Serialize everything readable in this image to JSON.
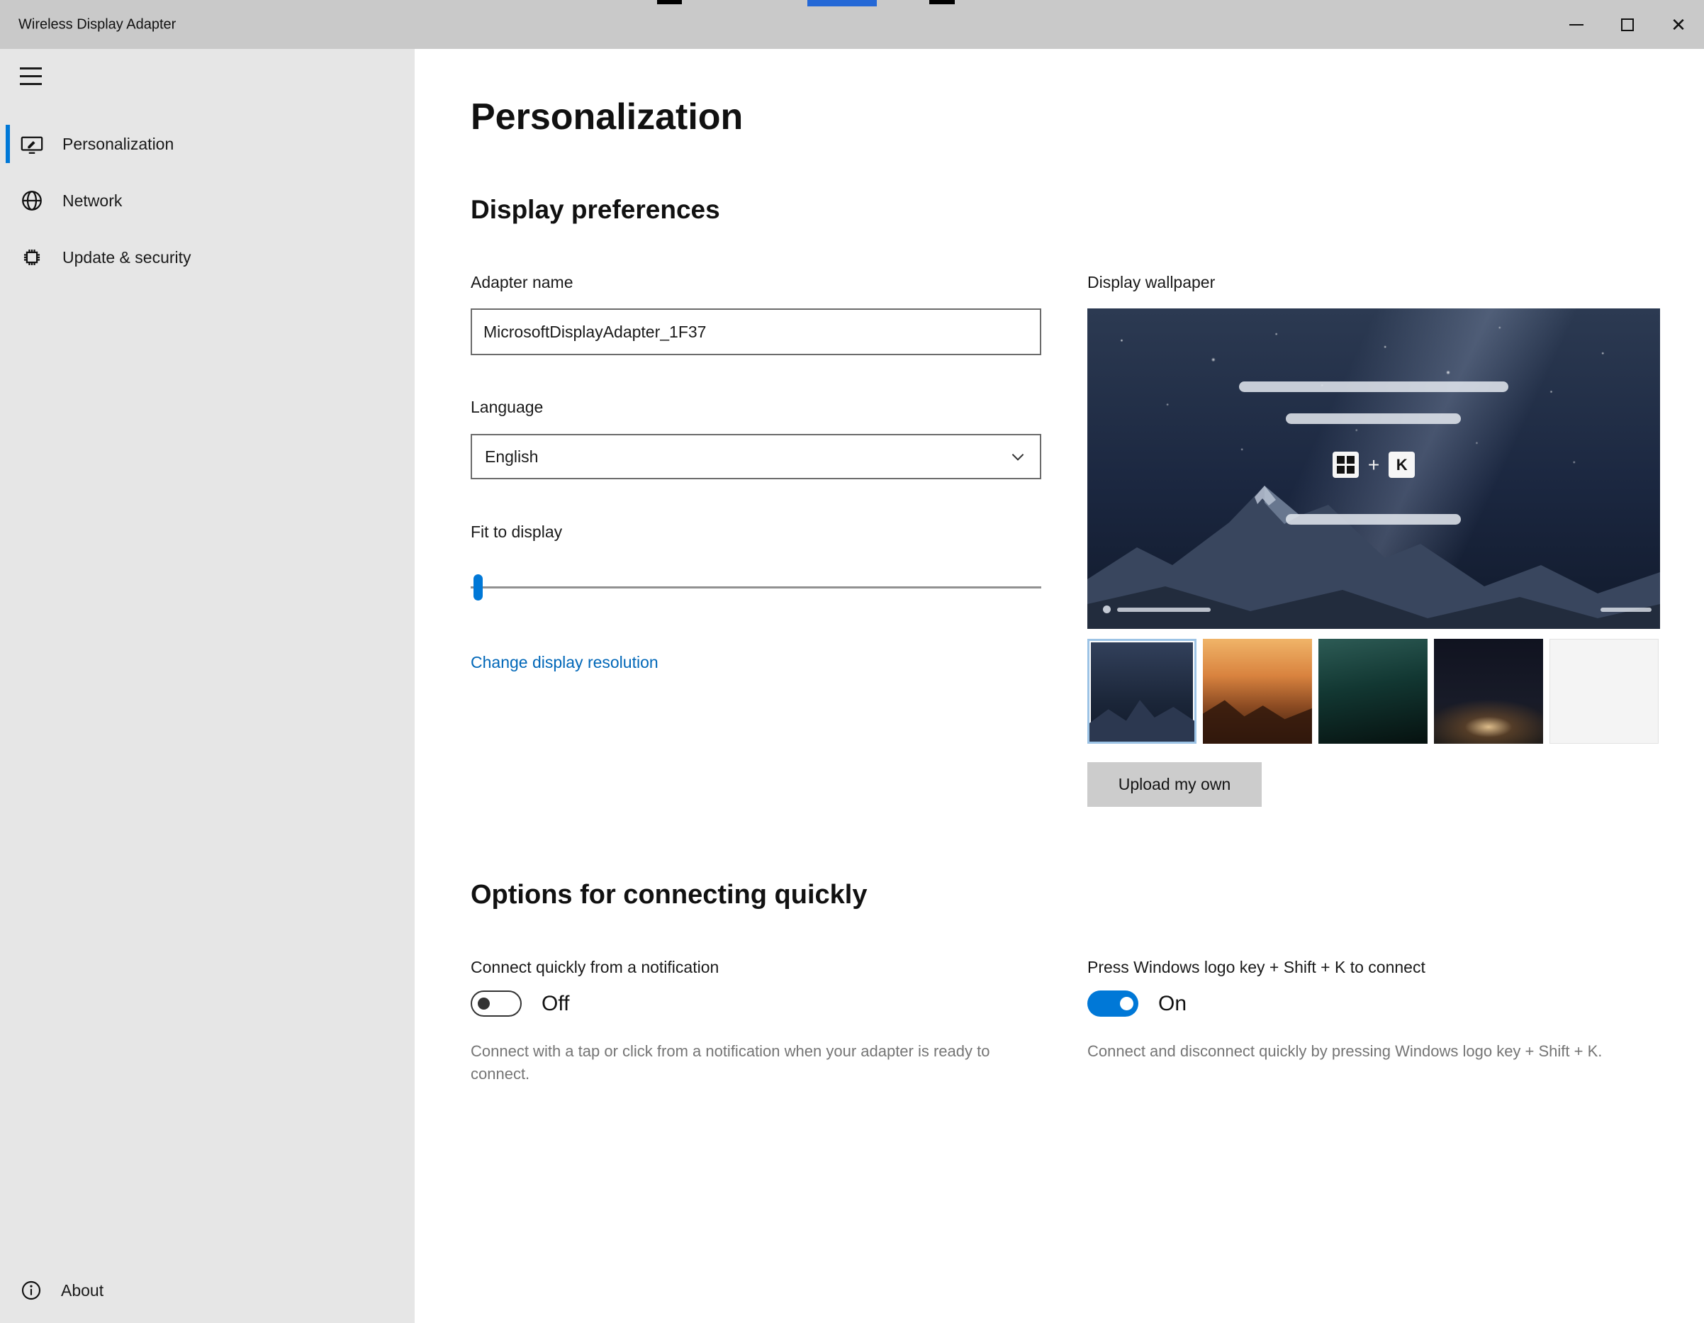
{
  "titlebar": {
    "title": "Wireless Display Adapter",
    "close_glyph": "✕"
  },
  "sidebar": {
    "items": [
      {
        "label": "Personalization"
      },
      {
        "label": "Network"
      },
      {
        "label": "Update & security"
      }
    ],
    "about_label": "About"
  },
  "page": {
    "title": "Personalization",
    "display_preferences": {
      "heading": "Display preferences",
      "adapter_name_label": "Adapter name",
      "adapter_name_value": "MicrosoftDisplayAdapter_1F37",
      "language_label": "Language",
      "language_value": "English",
      "fit_to_display_label": "Fit to display",
      "change_resolution_link": "Change display resolution"
    },
    "wallpaper": {
      "label": "Display wallpaper",
      "plus_glyph": "+",
      "key_glyph": "K",
      "upload_button": "Upload my own"
    },
    "options": {
      "heading": "Options for connecting quickly",
      "notification": {
        "label": "Connect quickly from a notification",
        "state": "Off",
        "description": "Connect with a tap or click from a notification when your adapter is ready to connect."
      },
      "hotkey": {
        "label": "Press Windows logo key + Shift + K to connect",
        "state": "On",
        "description": "Connect and disconnect quickly by pressing Windows logo key + Shift + K."
      }
    }
  },
  "colors": {
    "accent": "#0078d7",
    "link": "#0067b8"
  }
}
